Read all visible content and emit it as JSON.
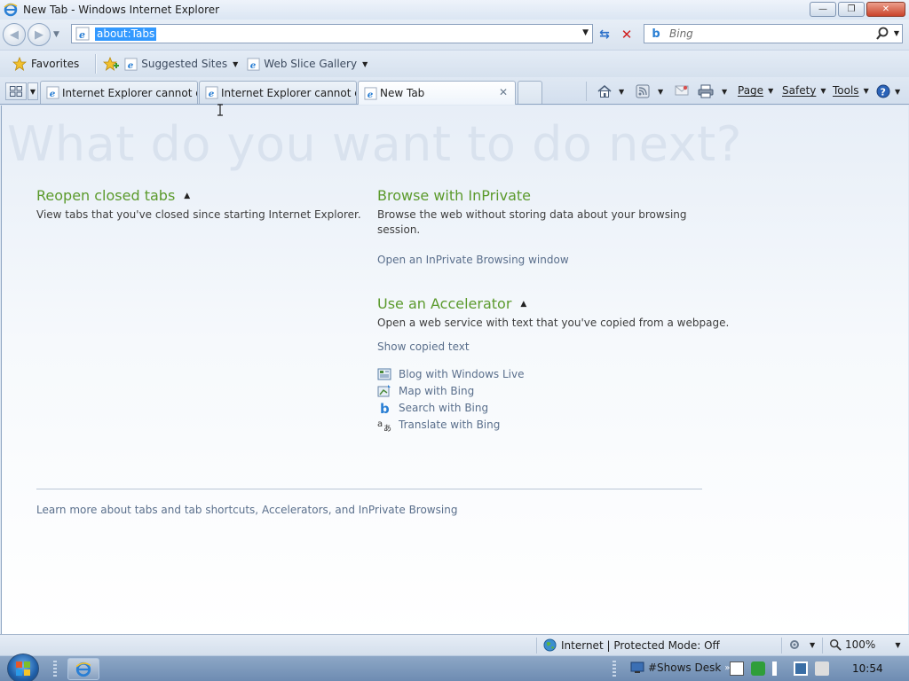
{
  "window": {
    "title": "New Tab - Windows Internet Explorer",
    "minimize_label": "—",
    "maximize_label": "❐",
    "close_label": "✕"
  },
  "address": {
    "url": "about:Tabs"
  },
  "search": {
    "placeholder": "Bing"
  },
  "favorites": {
    "favorites_label": "Favorites",
    "items": [
      {
        "label": "Suggested Sites"
      },
      {
        "label": "Web Slice Gallery"
      }
    ]
  },
  "tabs": [
    {
      "label": "Internet Explorer cannot di..."
    },
    {
      "label": "Internet Explorer cannot di..."
    },
    {
      "label": "New Tab"
    }
  ],
  "commands": {
    "page": "Page",
    "safety": "Safety",
    "tools": "Tools"
  },
  "content": {
    "headline": "What do you want to do next?",
    "reopen": {
      "title": "Reopen closed tabs",
      "desc": "View tabs that you've closed since starting Internet Explorer."
    },
    "inprivate": {
      "title": "Browse with InPrivate",
      "desc": "Browse the web without storing data about your browsing session.",
      "link": "Open an InPrivate Browsing window"
    },
    "accelerator": {
      "title": "Use an Accelerator",
      "desc": "Open a web service with text that you've copied from a webpage.",
      "show_link": "Show copied text",
      "items": [
        {
          "label": "Blog with Windows Live",
          "icon": "blog-icon"
        },
        {
          "label": "Map with Bing",
          "icon": "map-icon"
        },
        {
          "label": "Search with Bing",
          "icon": "bing-icon"
        },
        {
          "label": "Translate with Bing",
          "icon": "translate-icon"
        }
      ]
    },
    "learn_more": "Learn more about tabs and tab shortcuts, Accelerators, and InPrivate Browsing"
  },
  "status": {
    "zone": "Internet | Protected Mode: Off",
    "zoom": "100%"
  },
  "taskbar": {
    "desk": "#Shows Desk",
    "clock": "10:54"
  },
  "colors": {
    "section_title": "#5b9a2c",
    "link": "#5a6f8c",
    "url_highlight": "#3399ff"
  }
}
